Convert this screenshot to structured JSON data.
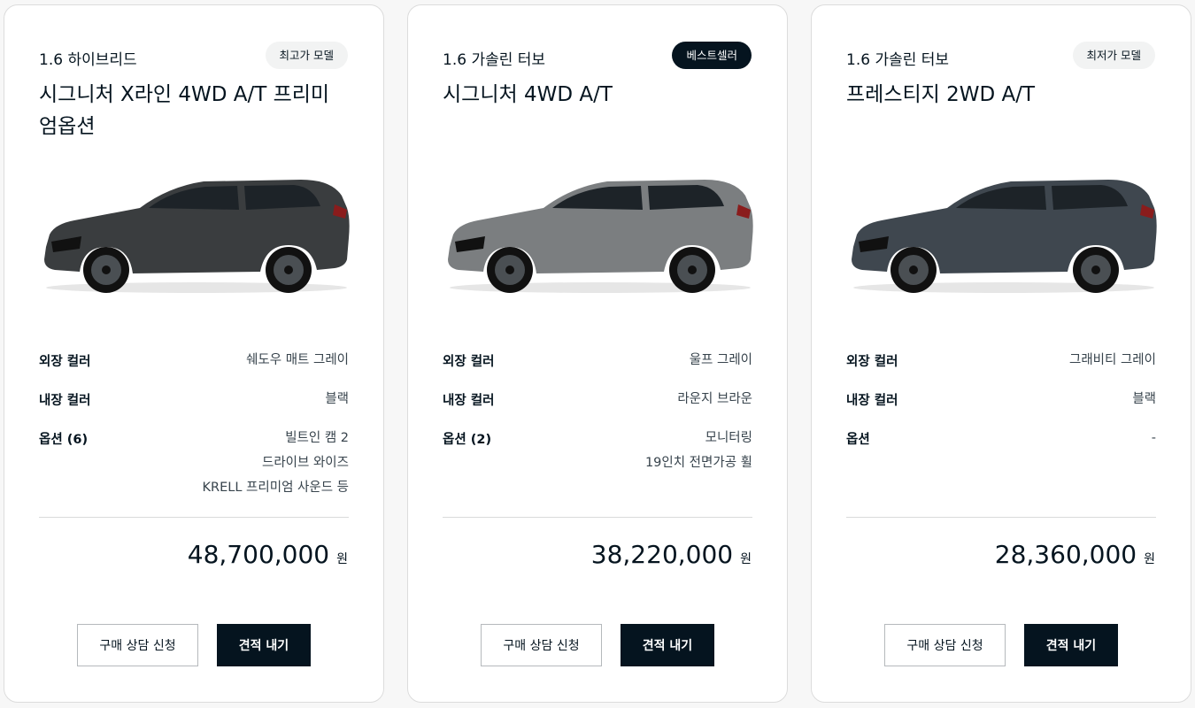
{
  "cards": [
    {
      "engine": "1.6 하이브리드",
      "badge": "최고가 모델",
      "badge_style": "light",
      "model": "시그니처 X라인 4WD A/T 프리미엄옵션",
      "car_color": "#3a3d3f",
      "specs": {
        "exterior_label": "외장 컬러",
        "exterior_value": "쉐도우 매트 그레이",
        "interior_label": "내장 컬러",
        "interior_value": "블랙",
        "options_label": "옵션 (6)",
        "options_values": [
          "빌트인 캠 2",
          "드라이브 와이즈",
          "KRELL 프리미엄 사운드 등"
        ]
      },
      "price": "48,700,000",
      "price_unit": "원",
      "consult_label": "구매 상담 신청",
      "quote_label": "견적 내기"
    },
    {
      "engine": "1.6 가솔린 터보",
      "badge": "베스트셀러",
      "badge_style": "dark",
      "model": "시그니처 4WD A/T",
      "car_color": "#7b7e80",
      "specs": {
        "exterior_label": "외장 컬러",
        "exterior_value": "울프 그레이",
        "interior_label": "내장 컬러",
        "interior_value": "라운지 브라운",
        "options_label": "옵션 (2)",
        "options_values": [
          "모니터링",
          "19인치 전면가공 휠"
        ]
      },
      "price": "38,220,000",
      "price_unit": "원",
      "consult_label": "구매 상담 신청",
      "quote_label": "견적 내기"
    },
    {
      "engine": "1.6 가솔린 터보",
      "badge": "최저가 모델",
      "badge_style": "light",
      "model": "프레스티지 2WD A/T",
      "car_color": "#3f474f",
      "specs": {
        "exterior_label": "외장 컬러",
        "exterior_value": "그래비티 그레이",
        "interior_label": "내장 컬러",
        "interior_value": "블랙",
        "options_label": "옵션",
        "options_values": [
          "-"
        ]
      },
      "price": "28,360,000",
      "price_unit": "원",
      "consult_label": "구매 상담 신청",
      "quote_label": "견적 내기"
    }
  ]
}
